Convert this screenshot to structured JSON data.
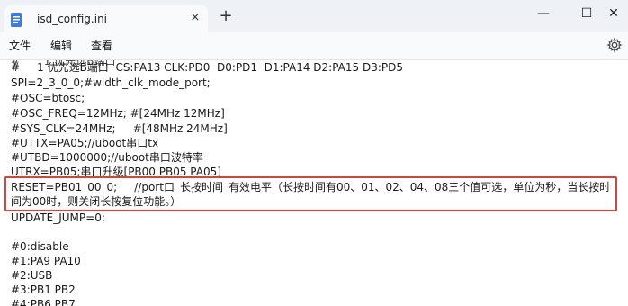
{
  "window": {
    "tab_title": "isd_config.ini",
    "close_tab_icon": "×",
    "new_tab_icon": "+",
    "minimize_icon": "—",
    "maximize_icon": "☐",
    "close_icon": "✕"
  },
  "menu": {
    "file": "文件",
    "edit": "编辑",
    "view": "查看"
  },
  "icons": {
    "file": "notepad-file-icon",
    "settings": "gear-icon"
  },
  "editor": {
    "lines": [
      "#       1 优先选B端口",
      "#     1 优先选B端口  CS:PA13 CLK:PD0  D0:PD1  D1:PA14 D2:PA15 D3:PD5",
      "SPI=2_3_0_0;#width_clk_mode_port;",
      "#OSC=btosc;",
      "#OSC_FREQ=12MHz; #[24MHz 12MHz]",
      "#SYS_CLK=24MHz;     #[48MHz 24MHz]",
      "#UTTX=PA05;//uboot串口tx",
      "#UTBD=1000000;//uboot串口波特率",
      "UTRX=PB05;串口升级[PB00 PB05 PA05]",
      "RESET=PB01_00_0;     //port口_长按时间_有效电平（长按时间有00、01、02、04、08三个值可选，单位为秒，当长按时",
      "间为00时，则关闭长按复位功能。）",
      "UPDATE_JUMP=0;",
      "",
      "#0:disable",
      "#1:PA9 PA10",
      "#2:USB",
      "#3:PB1 PB2",
      "#4:PB6 PB7"
    ]
  },
  "highlight_color": "#d9433a"
}
